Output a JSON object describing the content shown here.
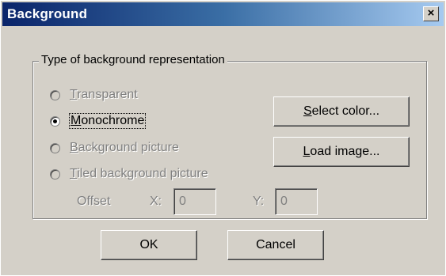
{
  "window": {
    "title": "Background",
    "close_label": "×"
  },
  "group": {
    "legend": "Type of background representation"
  },
  "options": [
    {
      "label": "Transparent",
      "mnemonic": "T",
      "rest": "ransparent",
      "selected": false,
      "enabled": false
    },
    {
      "label": "Monochrome",
      "mnemonic": "M",
      "rest": "onochrome",
      "selected": true,
      "enabled": true
    },
    {
      "label": "Background picture",
      "mnemonic": "B",
      "rest": "ackground picture",
      "selected": false,
      "enabled": false
    },
    {
      "label": "Tiled background picture",
      "mnemonic": "T",
      "rest": "iled background picture",
      "selected": false,
      "enabled": false
    }
  ],
  "buttons": {
    "select_color": {
      "mnemonic": "S",
      "rest": "elect color..."
    },
    "load_image": {
      "mnemonic": "L",
      "rest": "oad image..."
    },
    "ok": "OK",
    "cancel": "Cancel"
  },
  "offset": {
    "label": "Offset",
    "x_label": "X:",
    "x_value": "0",
    "y_label": "Y:",
    "y_value": "0"
  }
}
